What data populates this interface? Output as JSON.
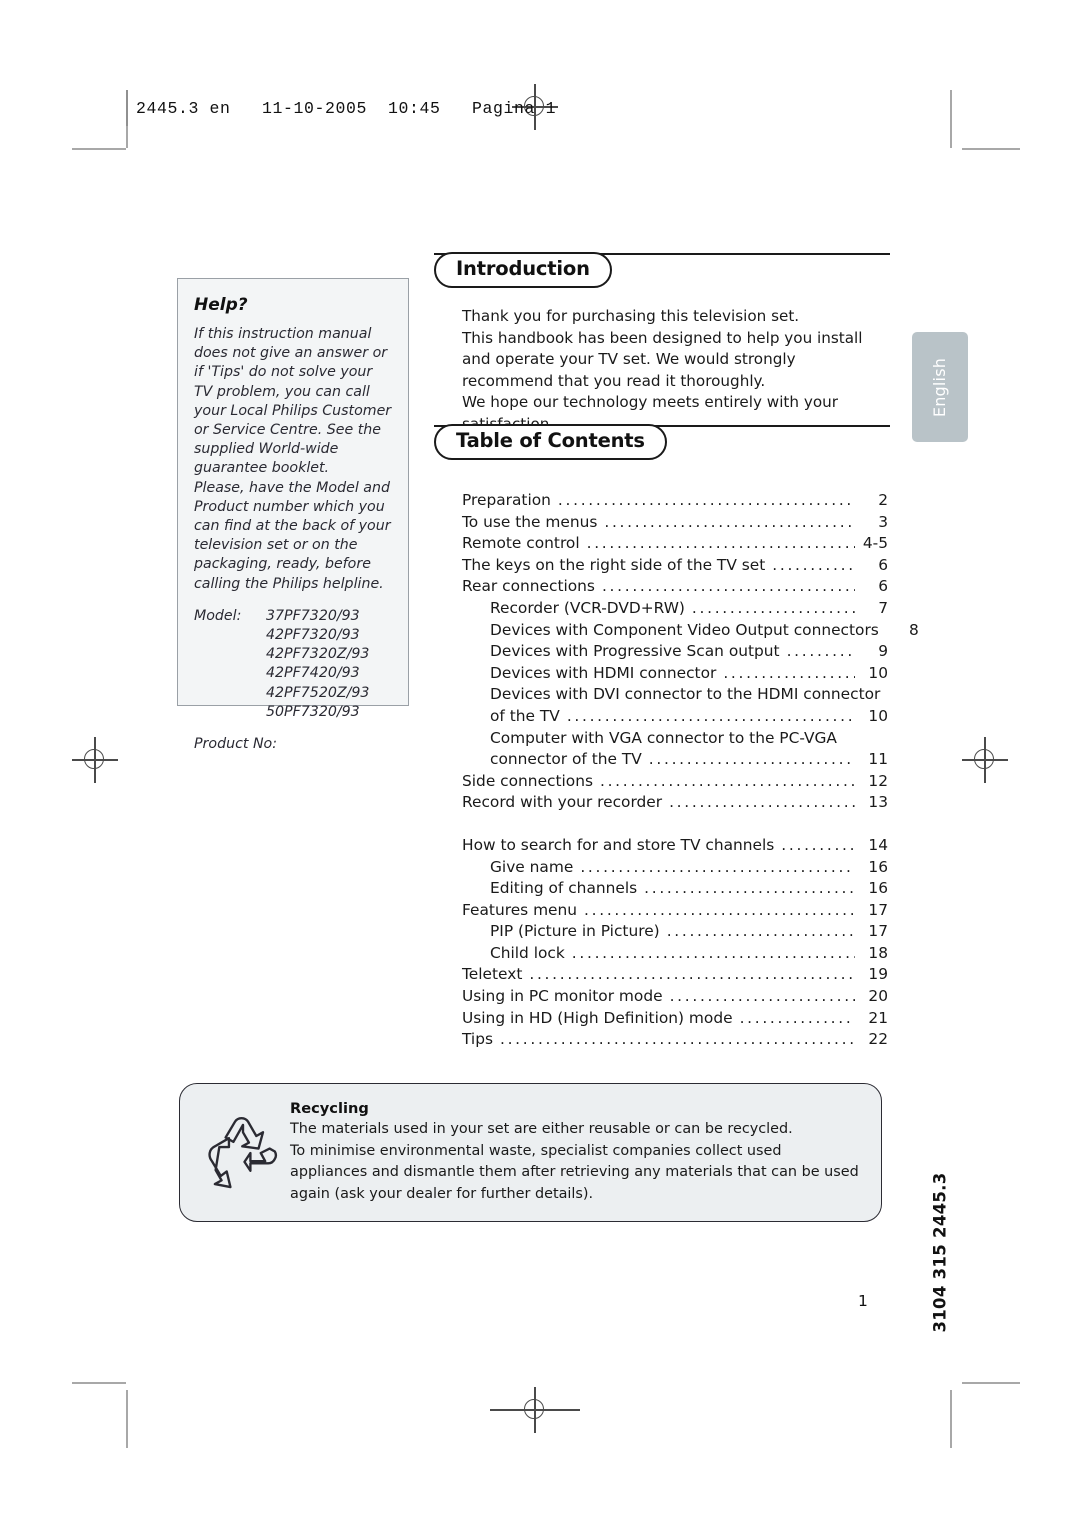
{
  "print_header": {
    "text": "2445.3 en   11-10-2005  10:45   Pagina 1"
  },
  "help_box": {
    "title": "Help?",
    "paragraphs": [
      "If this instruction manual does not give an answer or if 'Tips' do not solve your TV problem, you can call your Local Philips Customer or Service Centre. See the supplied World-wide guarantee booklet.",
      "Please, have the Model and Product number which you can find at the back of your television set or on the packaging, ready, before calling the Philips helpline."
    ],
    "model_label": "Model:",
    "models": [
      "37PF7320/93",
      "42PF7320/93",
      "42PF7320Z/93",
      "42PF7420/93",
      "42PF7520Z/93",
      "50PF7320/93"
    ],
    "product_no_label": "Product No:"
  },
  "introduction": {
    "heading": "Introduction",
    "paragraphs": [
      "Thank you for purchasing this television set.",
      "This handbook has been designed to help you install and operate your TV set. We would strongly recommend that you read it thoroughly.",
      "We hope our technology meets entirely with your satisfaction."
    ]
  },
  "table_of_contents": {
    "heading": "Table of Contents",
    "entries": [
      {
        "label": "Preparation",
        "page": "2",
        "indent": false,
        "dots": true
      },
      {
        "label": "To use the menus",
        "page": "3",
        "indent": false,
        "dots": true
      },
      {
        "label": "Remote control",
        "page": "4-5",
        "indent": false,
        "dots": true
      },
      {
        "label": "The keys on the right side of the TV set",
        "page": "6",
        "indent": false,
        "dots": true
      },
      {
        "label": "Rear connections",
        "page": "6",
        "indent": false,
        "dots": true
      },
      {
        "label": "Recorder (VCR-DVD+RW)",
        "page": "7",
        "indent": true,
        "dots": true
      },
      {
        "label": "Devices with Component Video Output connectors",
        "page": "8",
        "indent": true,
        "dots": true
      },
      {
        "label": "Devices with Progressive Scan output",
        "page": "9",
        "indent": true,
        "dots": true
      },
      {
        "label": "Devices with HDMI connector",
        "page": "10",
        "indent": true,
        "dots": true
      },
      {
        "label": "Devices with DVI connector to the HDMI connector",
        "page": "",
        "indent": true,
        "dots": false
      },
      {
        "label": "of the TV",
        "page": "10",
        "indent": true,
        "dots": true
      },
      {
        "label": "Computer with VGA connector to the PC-VGA",
        "page": "",
        "indent": true,
        "dots": false
      },
      {
        "label": "connector of the TV",
        "page": "11",
        "indent": true,
        "dots": true
      },
      {
        "label": "Side connections",
        "page": "12",
        "indent": false,
        "dots": true
      },
      {
        "label": "Record with your recorder",
        "page": "13",
        "indent": false,
        "dots": true
      },
      {
        "label": "",
        "page": "",
        "indent": false,
        "dots": false,
        "gap": true
      },
      {
        "label": "How to search for and store TV channels",
        "page": "14",
        "indent": false,
        "dots": true
      },
      {
        "label": "Give name",
        "page": "16",
        "indent": true,
        "dots": true
      },
      {
        "label": "Editing of channels",
        "page": "16",
        "indent": true,
        "dots": true
      },
      {
        "label": "Features menu",
        "page": "17",
        "indent": false,
        "dots": true
      },
      {
        "label": "PIP (Picture in Picture)",
        "page": "17",
        "indent": true,
        "dots": true
      },
      {
        "label": "Child lock",
        "page": "18",
        "indent": true,
        "dots": true
      },
      {
        "label": "Teletext",
        "page": "19",
        "indent": false,
        "dots": true
      },
      {
        "label": "Using in PC monitor mode",
        "page": "20",
        "indent": false,
        "dots": true
      },
      {
        "label": "Using in HD (High Definition) mode",
        "page": "21",
        "indent": false,
        "dots": true
      },
      {
        "label": "Tips",
        "page": "22",
        "indent": false,
        "dots": true
      }
    ]
  },
  "recycling": {
    "icon": "recycle-icon",
    "title": "Recycling",
    "paragraphs": [
      "The materials used in your set are either reusable or can be recycled.",
      "To minimise environmental waste, specialist companies collect used appliances and dismantle them after retrieving any materials that can be used again (ask your dealer for further details)."
    ]
  },
  "language_tab": {
    "label": "English",
    "color": "#b9c3c8"
  },
  "document_code": {
    "text": "3104 315 2445.3"
  },
  "page_number": {
    "value": "1"
  }
}
